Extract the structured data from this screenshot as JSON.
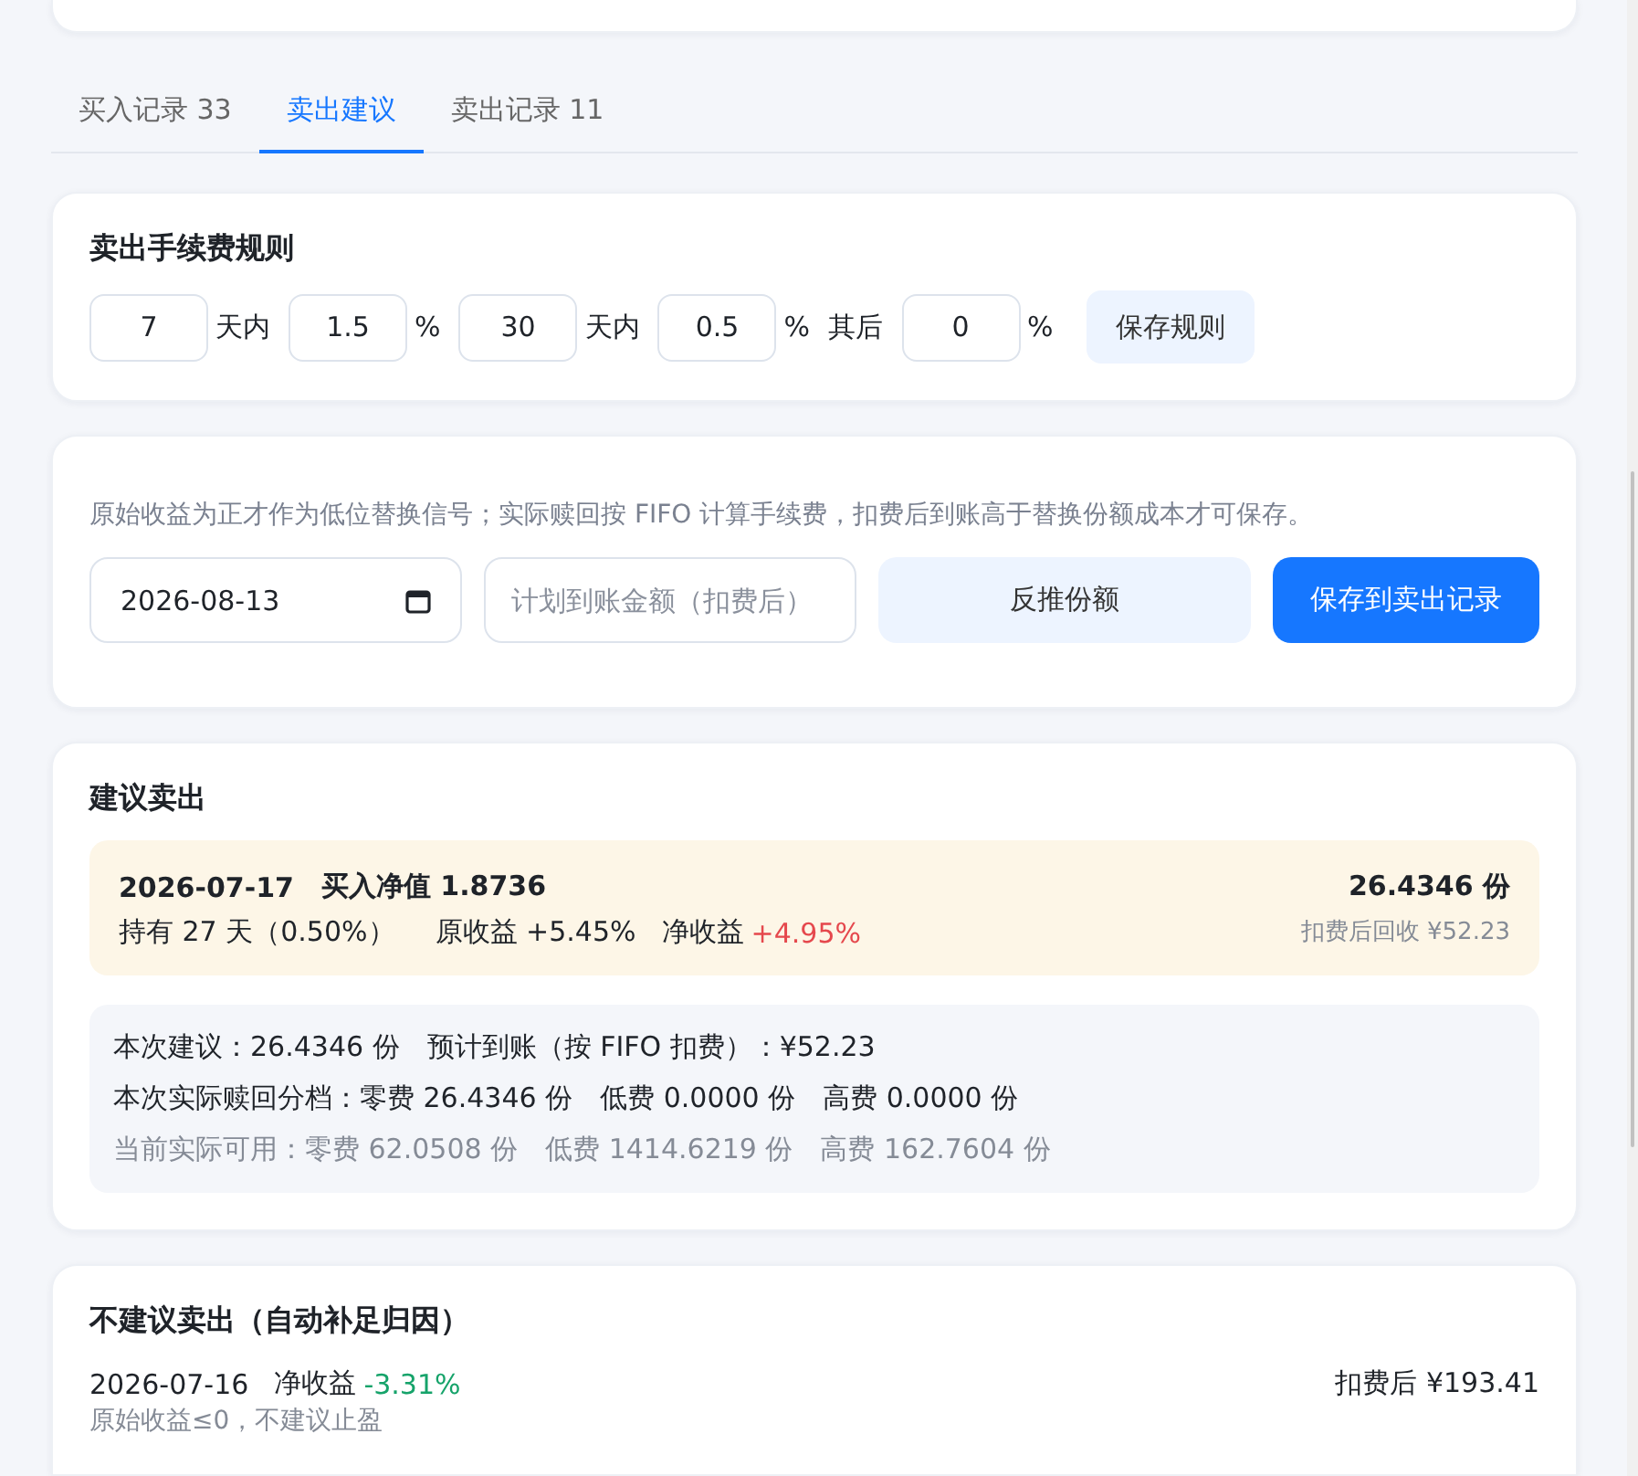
{
  "tabs": [
    {
      "label": "买入记录 33",
      "selected": false
    },
    {
      "label": "卖出建议",
      "selected": true
    },
    {
      "label": "卖出记录 11",
      "selected": false
    }
  ],
  "fee_rules": {
    "title": "卖出手续费规则",
    "fields": [
      {
        "kind": "input",
        "text": "7"
      },
      {
        "kind": "unit",
        "text": "天内"
      },
      {
        "kind": "input",
        "text": "1.5"
      },
      {
        "kind": "unit",
        "text": "%"
      },
      {
        "kind": "input",
        "text": "30"
      },
      {
        "kind": "unit",
        "text": "天内"
      },
      {
        "kind": "input",
        "text": "0.5"
      },
      {
        "kind": "unit",
        "text": "%"
      },
      {
        "kind": "unit",
        "text": "其后"
      },
      {
        "kind": "input",
        "text": "0"
      },
      {
        "kind": "unit",
        "text": "%"
      }
    ],
    "button": "保存规则"
  },
  "replace": {
    "hint": "原始收益为正才作为低位替换信号；实际赎回按 FIFO 计算手续费，扣费后到账高于替换份额成本才可保存。",
    "date": "2026-08-13",
    "amount_placeholder": "计划到账金额（扣费后）",
    "buttons": [
      {
        "kind": "secondary",
        "label": "反推份额"
      },
      {
        "kind": "primary",
        "label": "保存到卖出记录"
      }
    ]
  },
  "suggest": {
    "title": "建议卖出",
    "lot": {
      "date": "2026-07-17",
      "nav": "买入净值 1.8736",
      "hold": "持有 27 天（0.50%）",
      "raw": "原收益 +5.45%",
      "net_label": "净收益",
      "net_value": "+4.95%",
      "positive": true,
      "shares": "26.4346 份",
      "recover": "扣费后回收 ¥52.23"
    },
    "summary": [
      {
        "text": "本次建议：26.4346 份　预计到账（按 FIFO 扣费）：¥52.23",
        "muted": false
      },
      {
        "text": "本次实际赎回分档：零费 26.4346 份　低费 0.0000 份　高费 0.0000 份",
        "muted": false
      },
      {
        "text": "当前实际可用：零费 62.0508 份　低费 1414.6219 份　高费 162.7604 份",
        "muted": true
      }
    ]
  },
  "not_suggest": {
    "title": "不建议卖出（自动补足归因）",
    "rows": [
      {
        "date": "2026-07-16",
        "net_label": "净收益",
        "net_value": "-3.31%",
        "positive": false,
        "amount": "扣费后 ¥193.41",
        "note": "原始收益≤0，不建议止盈"
      }
    ]
  }
}
